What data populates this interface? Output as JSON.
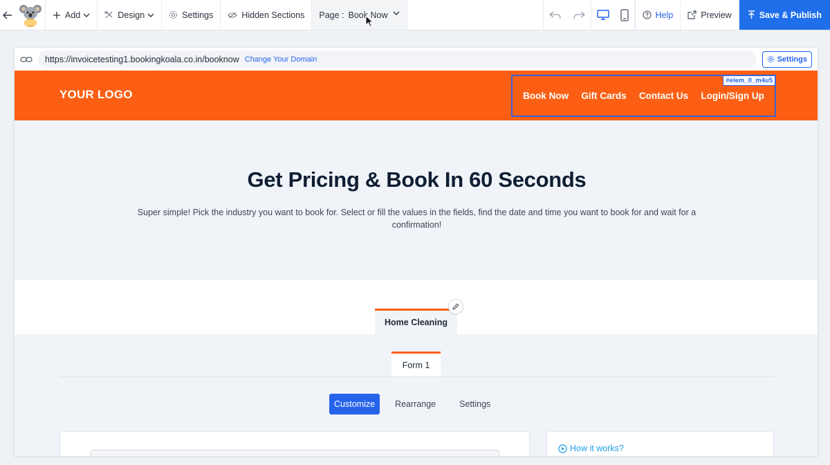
{
  "toolbar": {
    "add_label": "Add",
    "design_label": "Design",
    "settings_label": "Settings",
    "hidden_sections_label": "Hidden Sections",
    "page_prefix": "Page :",
    "page_name": "Book Now",
    "help_label": "Help",
    "preview_label": "Preview",
    "publish_label": "Save & Publish"
  },
  "frame": {
    "url": "https://invoicetesting1.bookingkoala.co.in/booknow",
    "change_domain": "Change Your Domain",
    "settings_label": "Settings"
  },
  "site": {
    "logo": "YOUR LOGO",
    "nav": [
      "Book Now",
      "Gift Cards",
      "Contact Us",
      "Login/Sign Up"
    ],
    "element_id": "#elem_0_m4u5"
  },
  "hero": {
    "title": "Get Pricing & Book In 60 Seconds",
    "subtitle": "Super simple! Pick the industry you want to book for. Select or fill the values in the fields, find the date and time you want to book for and wait for a confirmation!"
  },
  "booking": {
    "industry_tab": "Home Cleaning",
    "form_tab": "Form 1",
    "subtabs": [
      "Customize",
      "Rearrange",
      "Settings"
    ],
    "how_it_works": "How it works?"
  },
  "colors": {
    "brand_orange": "#fc5f13",
    "primary_blue": "#2563eb",
    "link_cyan": "#1ea0e6"
  }
}
